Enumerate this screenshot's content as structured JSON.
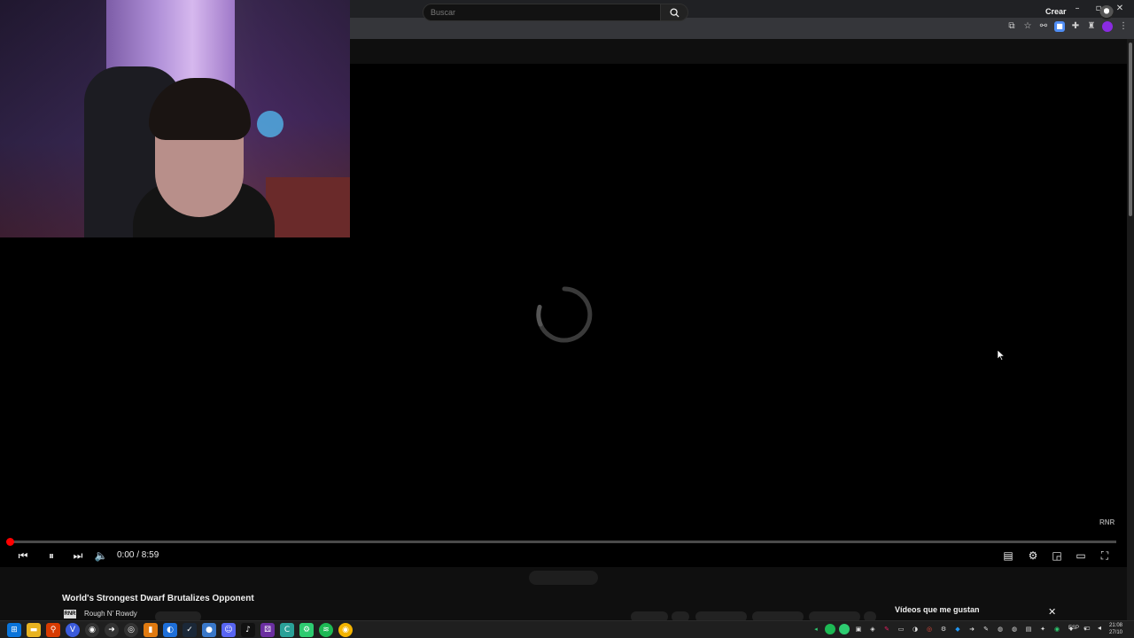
{
  "window": {
    "controls": {
      "minimize": "–",
      "maximize": "▫",
      "close": "✕"
    }
  },
  "header": {
    "search_placeholder": "Buscar",
    "create_label": "Crear"
  },
  "player": {
    "watermark": "RNR",
    "time": "0:00 / 8:59",
    "progress_fraction": 0.0,
    "state": "loading"
  },
  "video": {
    "title": "World's Strongest Dwarf Brutalizes Opponent",
    "channel_name": "Rough N' Rowdy",
    "channel_logo_text": "RNR"
  },
  "playlist_panel": {
    "title": "Vídeos que me gustan"
  },
  "taskbar": {
    "language": "ESP",
    "time": "21:08",
    "date": "27/10"
  }
}
